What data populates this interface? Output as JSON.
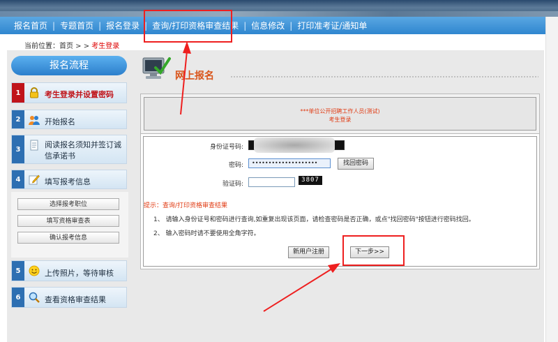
{
  "nav": {
    "items": [
      "报名首页",
      "专题首页",
      "报名登录",
      "查询/打印资格审查结果",
      "信息修改",
      "打印准考证/通知单"
    ],
    "separator": "|"
  },
  "breadcrumb": {
    "label": "当前位置：首页 > > ",
    "current": "考生登录"
  },
  "sidebar": {
    "title": "报名流程",
    "steps": [
      {
        "num": "1",
        "label": "考生登录并设置密码",
        "icon": "lock-icon"
      },
      {
        "num": "2",
        "label": "开始报名",
        "icon": "users-icon"
      },
      {
        "num": "3",
        "label_line1": "阅读报名须知并签订诚",
        "label_line2": "信承诺书",
        "icon": "document-icon"
      },
      {
        "num": "4",
        "label": "填写报考信息",
        "icon": "pencil-note-icon"
      },
      {
        "num": "5",
        "label": "上传照片，等待审核",
        "icon": "smiley-icon"
      },
      {
        "num": "6",
        "label": "查看资格审查结果",
        "icon": "magnifier-icon"
      }
    ],
    "subitems": [
      "选择报考职位",
      "填写资格审查表",
      "确认报考信息"
    ]
  },
  "main": {
    "title": "网上报名",
    "exam_name": "***单位公开招聘工作人员(测试)",
    "subtitle": "考生登录",
    "form": {
      "id_label": "身份证号码:",
      "password_label": "密码:",
      "password_value": "••••••••••••••••••••",
      "retrieve_button": "找回密码",
      "captcha_label": "验证码:",
      "captcha_text": "3807"
    },
    "tips": {
      "heading": "提示：查询/打印资格审查结果",
      "line1": "1、 请输入身份证号和密码进行查询,如重复出现该页面，请检查密码是否正确，或点\"找回密码\"按钮进行密码找回。",
      "line2": "2、 输入密码时请不要使用全角字符。"
    },
    "register_button": "新用户注册",
    "next_button": "下一步>>"
  },
  "colors": {
    "nav_blue": "#2f86cf",
    "annotation_red": "#ee1f1f",
    "title_orange": "#d9541a",
    "active_step_red": "#c0141a"
  }
}
